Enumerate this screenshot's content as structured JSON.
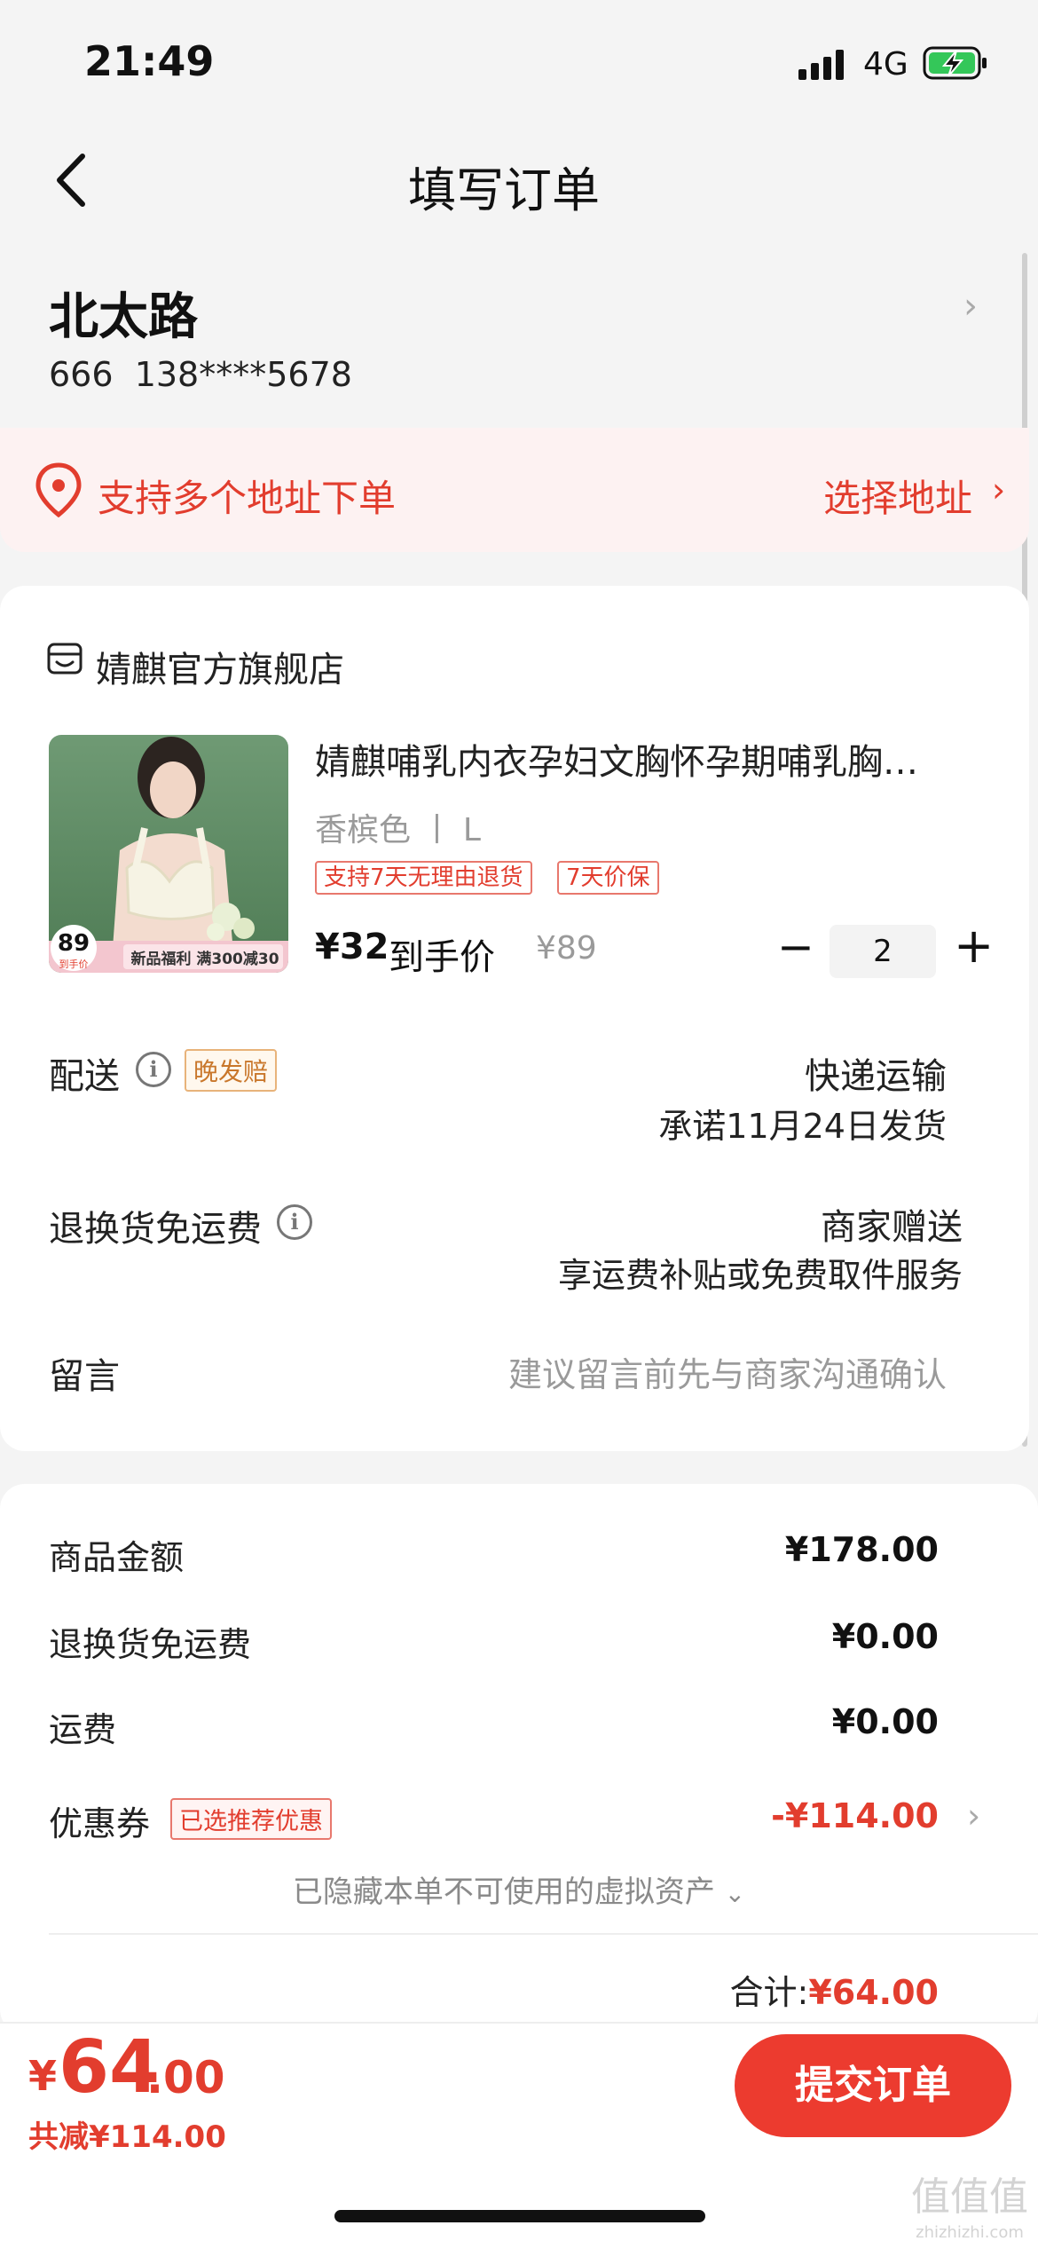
{
  "status_bar": {
    "time": "21:49",
    "network": "4G"
  },
  "header": {
    "title": "填写订单"
  },
  "address": {
    "name": "北太路",
    "phone": "666  138****5678"
  },
  "multi_address": {
    "text": "支持多个地址下单",
    "action": "选择地址"
  },
  "store": {
    "name": "婧麒官方旗舰店",
    "product": {
      "title": "婧麒哺乳内衣孕妇文胸怀孕期哺乳胸…",
      "spec": "香槟色 丨 L",
      "tags": [
        "支持7天无理由退货",
        "7天价保"
      ],
      "price": "¥32",
      "price_label": "到手价",
      "original_price": "¥89",
      "quantity": "2",
      "image": {
        "price_badge": "89",
        "price_badge_sub": "到手价",
        "banner": "新品福利 满300减30"
      }
    },
    "shipping": {
      "label": "配送",
      "badge": "晚发赔",
      "method": "快递运输",
      "promise": "承诺11月24日发货"
    },
    "return_shipping": {
      "label": "退换货免运费",
      "merchant": "商家赠送",
      "service": "享运费补贴或免费取件服务"
    },
    "message": {
      "label": "留言",
      "placeholder": "建议留言前先与商家沟通确认"
    }
  },
  "summary": {
    "rows": [
      {
        "label": "商品金额",
        "value": "¥178.00"
      },
      {
        "label": "退换货免运费",
        "value": "¥0.00"
      },
      {
        "label": "运费",
        "value": "¥0.00"
      },
      {
        "label": "优惠券",
        "value": "-¥114.00"
      }
    ],
    "coupon_badge": "已选推荐优惠",
    "hidden_assets_note": "已隐藏本单不可使用的虚拟资产",
    "total_label": "合计:",
    "total_value": "¥64.00"
  },
  "bottom_bar": {
    "currency": "¥",
    "amount_integer": "64",
    "amount_decimal": ".00",
    "discount": "共减¥114.00",
    "submit_label": "提交订单"
  },
  "watermark": {
    "logo": "值值值",
    "url": "zhizhizhi.com"
  },
  "colors": {
    "accent": "#ec3b2f",
    "accent_text": "#e23d2e",
    "banner_bg": "#fdf2f2",
    "page_bg": "#f4f4f4"
  }
}
